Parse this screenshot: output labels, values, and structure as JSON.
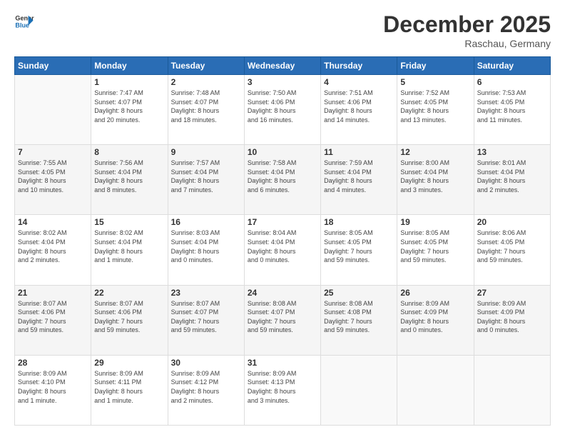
{
  "header": {
    "logo_line1": "General",
    "logo_line2": "Blue",
    "month": "December 2025",
    "location": "Raschau, Germany"
  },
  "weekdays": [
    "Sunday",
    "Monday",
    "Tuesday",
    "Wednesday",
    "Thursday",
    "Friday",
    "Saturday"
  ],
  "weeks": [
    [
      {
        "day": "",
        "info": ""
      },
      {
        "day": "1",
        "info": "Sunrise: 7:47 AM\nSunset: 4:07 PM\nDaylight: 8 hours\nand 20 minutes."
      },
      {
        "day": "2",
        "info": "Sunrise: 7:48 AM\nSunset: 4:07 PM\nDaylight: 8 hours\nand 18 minutes."
      },
      {
        "day": "3",
        "info": "Sunrise: 7:50 AM\nSunset: 4:06 PM\nDaylight: 8 hours\nand 16 minutes."
      },
      {
        "day": "4",
        "info": "Sunrise: 7:51 AM\nSunset: 4:06 PM\nDaylight: 8 hours\nand 14 minutes."
      },
      {
        "day": "5",
        "info": "Sunrise: 7:52 AM\nSunset: 4:05 PM\nDaylight: 8 hours\nand 13 minutes."
      },
      {
        "day": "6",
        "info": "Sunrise: 7:53 AM\nSunset: 4:05 PM\nDaylight: 8 hours\nand 11 minutes."
      }
    ],
    [
      {
        "day": "7",
        "info": "Sunrise: 7:55 AM\nSunset: 4:05 PM\nDaylight: 8 hours\nand 10 minutes."
      },
      {
        "day": "8",
        "info": "Sunrise: 7:56 AM\nSunset: 4:04 PM\nDaylight: 8 hours\nand 8 minutes."
      },
      {
        "day": "9",
        "info": "Sunrise: 7:57 AM\nSunset: 4:04 PM\nDaylight: 8 hours\nand 7 minutes."
      },
      {
        "day": "10",
        "info": "Sunrise: 7:58 AM\nSunset: 4:04 PM\nDaylight: 8 hours\nand 6 minutes."
      },
      {
        "day": "11",
        "info": "Sunrise: 7:59 AM\nSunset: 4:04 PM\nDaylight: 8 hours\nand 4 minutes."
      },
      {
        "day": "12",
        "info": "Sunrise: 8:00 AM\nSunset: 4:04 PM\nDaylight: 8 hours\nand 3 minutes."
      },
      {
        "day": "13",
        "info": "Sunrise: 8:01 AM\nSunset: 4:04 PM\nDaylight: 8 hours\nand 2 minutes."
      }
    ],
    [
      {
        "day": "14",
        "info": "Sunrise: 8:02 AM\nSunset: 4:04 PM\nDaylight: 8 hours\nand 2 minutes."
      },
      {
        "day": "15",
        "info": "Sunrise: 8:02 AM\nSunset: 4:04 PM\nDaylight: 8 hours\nand 1 minute."
      },
      {
        "day": "16",
        "info": "Sunrise: 8:03 AM\nSunset: 4:04 PM\nDaylight: 8 hours\nand 0 minutes."
      },
      {
        "day": "17",
        "info": "Sunrise: 8:04 AM\nSunset: 4:04 PM\nDaylight: 8 hours\nand 0 minutes."
      },
      {
        "day": "18",
        "info": "Sunrise: 8:05 AM\nSunset: 4:05 PM\nDaylight: 7 hours\nand 59 minutes."
      },
      {
        "day": "19",
        "info": "Sunrise: 8:05 AM\nSunset: 4:05 PM\nDaylight: 7 hours\nand 59 minutes."
      },
      {
        "day": "20",
        "info": "Sunrise: 8:06 AM\nSunset: 4:05 PM\nDaylight: 7 hours\nand 59 minutes."
      }
    ],
    [
      {
        "day": "21",
        "info": "Sunrise: 8:07 AM\nSunset: 4:06 PM\nDaylight: 7 hours\nand 59 minutes."
      },
      {
        "day": "22",
        "info": "Sunrise: 8:07 AM\nSunset: 4:06 PM\nDaylight: 7 hours\nand 59 minutes."
      },
      {
        "day": "23",
        "info": "Sunrise: 8:07 AM\nSunset: 4:07 PM\nDaylight: 7 hours\nand 59 minutes."
      },
      {
        "day": "24",
        "info": "Sunrise: 8:08 AM\nSunset: 4:07 PM\nDaylight: 7 hours\nand 59 minutes."
      },
      {
        "day": "25",
        "info": "Sunrise: 8:08 AM\nSunset: 4:08 PM\nDaylight: 7 hours\nand 59 minutes."
      },
      {
        "day": "26",
        "info": "Sunrise: 8:09 AM\nSunset: 4:09 PM\nDaylight: 8 hours\nand 0 minutes."
      },
      {
        "day": "27",
        "info": "Sunrise: 8:09 AM\nSunset: 4:09 PM\nDaylight: 8 hours\nand 0 minutes."
      }
    ],
    [
      {
        "day": "28",
        "info": "Sunrise: 8:09 AM\nSunset: 4:10 PM\nDaylight: 8 hours\nand 1 minute."
      },
      {
        "day": "29",
        "info": "Sunrise: 8:09 AM\nSunset: 4:11 PM\nDaylight: 8 hours\nand 1 minute."
      },
      {
        "day": "30",
        "info": "Sunrise: 8:09 AM\nSunset: 4:12 PM\nDaylight: 8 hours\nand 2 minutes."
      },
      {
        "day": "31",
        "info": "Sunrise: 8:09 AM\nSunset: 4:13 PM\nDaylight: 8 hours\nand 3 minutes."
      },
      {
        "day": "",
        "info": ""
      },
      {
        "day": "",
        "info": ""
      },
      {
        "day": "",
        "info": ""
      }
    ]
  ]
}
